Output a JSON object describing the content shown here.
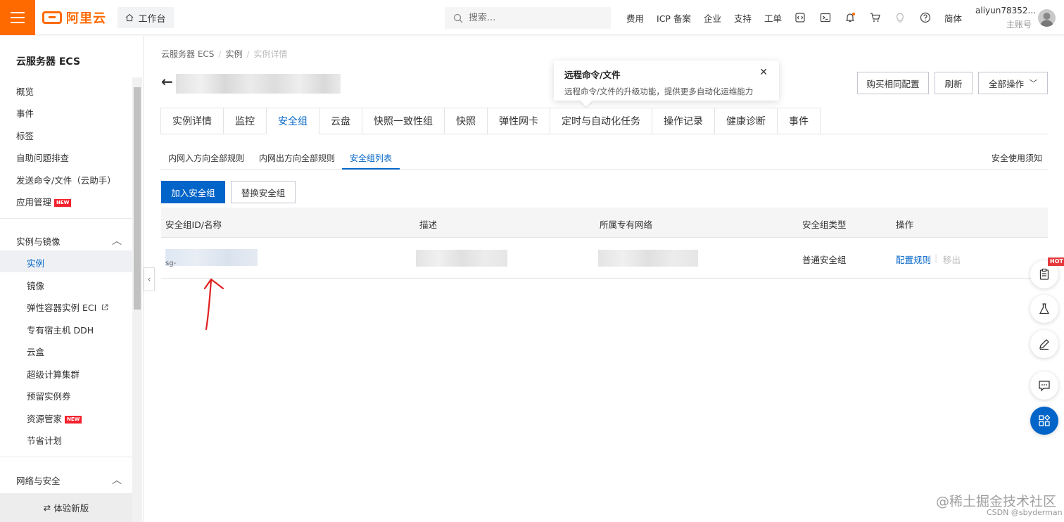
{
  "header": {
    "logo_text": "阿里云",
    "workbench": "工作台",
    "search_placeholder": "搜索...",
    "nav": [
      "费用",
      "ICP 备案",
      "企业",
      "支持",
      "工单"
    ],
    "lang": "简体",
    "user_name": "aliyun78352...",
    "user_role": "主账号",
    "brand_color": "#ff6a00"
  },
  "sidebar": {
    "title": "云服务器 ECS",
    "items": [
      "概览",
      "事件",
      "标签",
      "自助问题排查",
      "发送命令/文件（云助手）",
      "应用管理"
    ],
    "group1": "实例与镜像",
    "group1_items": [
      "实例",
      "镜像",
      "弹性容器实例 ECI",
      "专有宿主机 DDH",
      "云盒",
      "超级计算集群",
      "预留实例券",
      "资源管家",
      "节省计划"
    ],
    "group2": "网络与安全",
    "new_badge": "NEW",
    "footer": "体验新版"
  },
  "breadcrumb": [
    "云服务器 ECS",
    "实例",
    "实例详情"
  ],
  "popover": {
    "title": "远程命令/文件",
    "desc": "远程命令/文件的升级功能，提供更多自动化运维能力"
  },
  "actions": {
    "buy_same": "购买相同配置",
    "refresh": "刷新",
    "all_ops": "全部操作"
  },
  "tabs": [
    "实例详情",
    "监控",
    "安全组",
    "云盘",
    "快照一致性组",
    "快照",
    "弹性网卡",
    "定时与自动化任务",
    "操作记录",
    "健康诊断",
    "事件"
  ],
  "subtabs": [
    "内网入方向全部规则",
    "内网出方向全部规则",
    "安全组列表"
  ],
  "safety_note": "安全使用须知",
  "buttons": {
    "join": "加入安全组",
    "replace": "替换安全组"
  },
  "table": {
    "headers": [
      "安全组ID/名称",
      "描述",
      "所属专有网络",
      "安全组类型",
      "操作"
    ],
    "row": {
      "id_prefix": "sg-",
      "type": "普通安全组",
      "action_config": "配置规则",
      "action_remove": "移出"
    }
  },
  "hot_badge": "HOT",
  "watermark": "@稀土掘金技术社区",
  "watermark2": "CSDN @sbyderman",
  "accent_color": "#0064c8"
}
